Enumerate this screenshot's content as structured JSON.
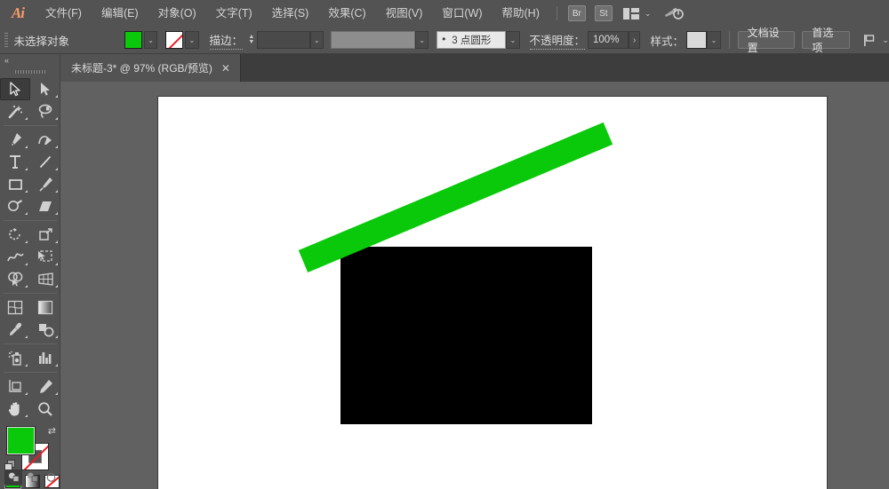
{
  "app": {
    "logo": "Ai",
    "accent_orange": "#f59b6b",
    "chrome_bg": "#535353",
    "canvas_bg": "#616161"
  },
  "menubar": {
    "items": [
      {
        "label": "文件(F)",
        "name": "menu-file"
      },
      {
        "label": "编辑(E)",
        "name": "menu-edit"
      },
      {
        "label": "对象(O)",
        "name": "menu-object"
      },
      {
        "label": "文字(T)",
        "name": "menu-type"
      },
      {
        "label": "选择(S)",
        "name": "menu-select"
      },
      {
        "label": "效果(C)",
        "name": "menu-effect"
      },
      {
        "label": "视图(V)",
        "name": "menu-view"
      },
      {
        "label": "窗口(W)",
        "name": "menu-window"
      },
      {
        "label": "帮助(H)",
        "name": "menu-help"
      }
    ],
    "bridge_label": "Br",
    "stock_label": "St",
    "arrange_caret": "⌄"
  },
  "controlbar": {
    "selection_status": "未选择对象",
    "fill_color": "#0ac90a",
    "stroke_color": "none",
    "stroke_label": "描边：",
    "stroke_weight_value": "",
    "brush_definition": "3 点圆形",
    "brush_bullet": "•",
    "opacity_label": "不透明度：",
    "opacity_value": "100%",
    "opacity_arrow": "›",
    "style_label": "样式：",
    "document_setup_label": "文档设置",
    "preferences_label": "首选项",
    "caret": "⌄"
  },
  "tabbar": {
    "tab_title": "未标题-3* @ 97% (RGB/预览)",
    "close_glyph": "✕"
  },
  "toolpanel": {
    "collapse_glyph": "«",
    "tools": [
      {
        "name": "selection-tool",
        "active": true
      },
      {
        "name": "direct-selection-tool",
        "active": false
      },
      {
        "name": "magic-wand-tool",
        "active": false
      },
      {
        "name": "lasso-tool",
        "active": false
      },
      {
        "name": "pen-tool",
        "active": false
      },
      {
        "name": "curvature-tool",
        "active": false
      },
      {
        "name": "type-tool",
        "active": false
      },
      {
        "name": "line-segment-tool",
        "active": false
      },
      {
        "name": "rectangle-tool",
        "active": false
      },
      {
        "name": "paintbrush-tool",
        "active": false
      },
      {
        "name": "shaper-tool",
        "active": false
      },
      {
        "name": "eraser-tool",
        "active": false
      },
      {
        "name": "rotate-tool",
        "active": false
      },
      {
        "name": "scale-tool",
        "active": false
      },
      {
        "name": "width-tool",
        "active": false
      },
      {
        "name": "free-transform-tool",
        "active": false
      },
      {
        "name": "shape-builder-tool",
        "active": false
      },
      {
        "name": "perspective-grid-tool",
        "active": false
      },
      {
        "name": "mesh-tool",
        "active": false
      },
      {
        "name": "gradient-tool",
        "active": false
      },
      {
        "name": "eyedropper-tool",
        "active": false
      },
      {
        "name": "blend-tool",
        "active": false
      },
      {
        "name": "symbol-sprayer-tool",
        "active": false
      },
      {
        "name": "column-graph-tool",
        "active": false
      },
      {
        "name": "artboard-tool",
        "active": false
      },
      {
        "name": "slice-tool",
        "active": false
      },
      {
        "name": "hand-tool",
        "active": false
      },
      {
        "name": "zoom-tool",
        "active": false
      }
    ],
    "fill_color": "#0ac90a",
    "stroke_color": "none",
    "swap_glyph": "⇄",
    "color_modes": [
      {
        "name": "color-mode-button",
        "kind": "color"
      },
      {
        "name": "gradient-mode-button",
        "kind": "gradient"
      },
      {
        "name": "none-mode-button",
        "kind": "none"
      }
    ],
    "screen_modes": [
      {
        "name": "normal-screen-mode-button",
        "active": true
      },
      {
        "name": "full-screen-with-menu-button",
        "active": false
      },
      {
        "name": "full-screen-mode-button",
        "active": false
      }
    ]
  },
  "canvas": {
    "artboard_fill": "#ffffff",
    "black_rect_color": "#000000",
    "green_bar_color": "#0ac90a",
    "green_bar_rotation_deg": "-22.8"
  }
}
